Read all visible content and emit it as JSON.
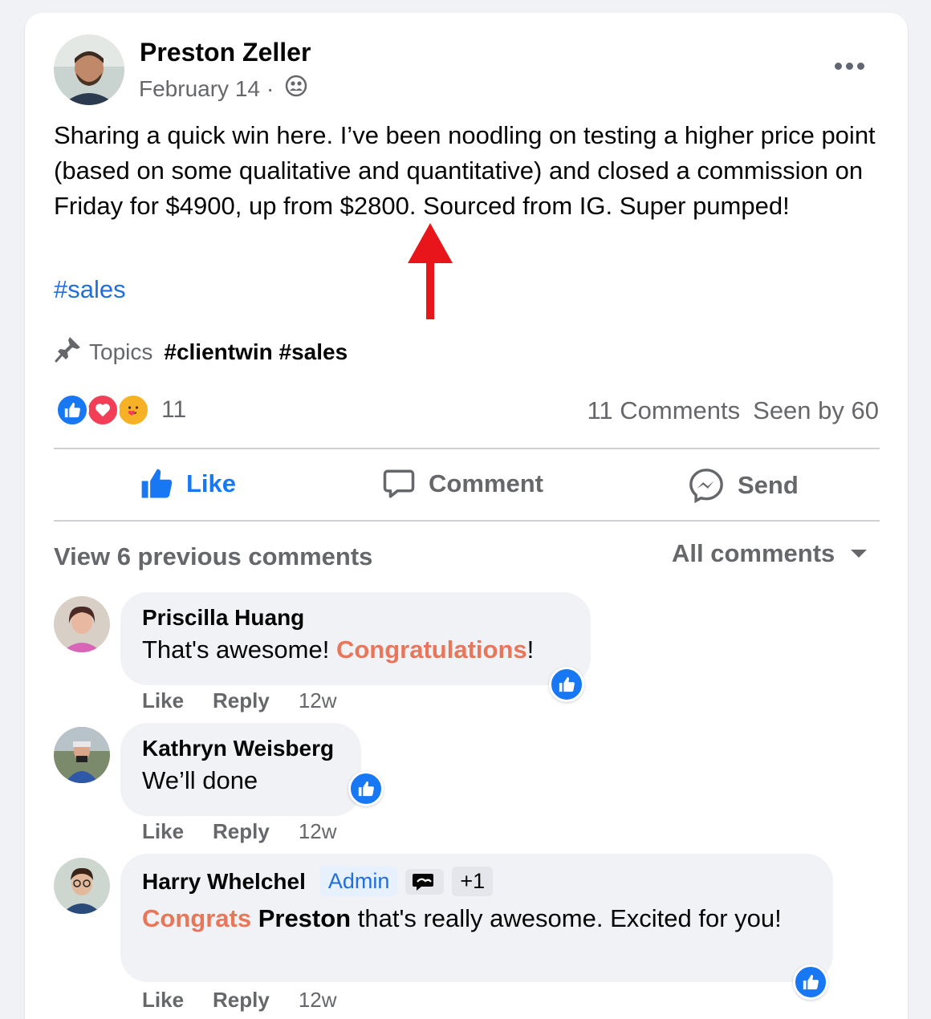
{
  "post": {
    "author": "Preston Zeller",
    "date": "February 14",
    "separator": "·",
    "text": "Sharing a quick win here. I’ve been noodling on testing a higher price point (based on some qualitative and quantitative) and closed a commission on Friday for $4900, up from $2800. Sourced from IG. Super pumped!",
    "hashtag": "#sales",
    "topics_label": "Topics",
    "topics_tags": "#clientwin #sales",
    "reaction_count": "11",
    "comments_count": "11 Comments",
    "seen_by": "Seen by 60"
  },
  "actions": {
    "like": "Like",
    "comment": "Comment",
    "send": "Send"
  },
  "comments_header": {
    "view_previous": "View 6 previous comments",
    "filter": "All comments"
  },
  "comments": [
    {
      "name": "Priscilla Huang",
      "text_before": "That's awesome! ",
      "text_accent": "Congratulations",
      "text_after": "!",
      "like": "Like",
      "reply": "Reply",
      "time": "12w"
    },
    {
      "name": "Kathryn Weisberg",
      "text": "We’ll done",
      "like": "Like",
      "reply": "Reply",
      "time": "12w"
    },
    {
      "name": "Harry Whelchel",
      "badge_admin": "Admin",
      "badge_extra": "+1",
      "text_accent": "Congrats",
      "text_mention": "Preston",
      "text_rest": " that's really awesome. Excited for you!",
      "like": "Like",
      "reply": "Reply",
      "time": "12w"
    }
  ],
  "colors": {
    "like_blue": "#1877f2",
    "hashtag_blue": "#216fdb",
    "accent_orange": "#e8765a",
    "annotation_red": "#e8161b"
  }
}
